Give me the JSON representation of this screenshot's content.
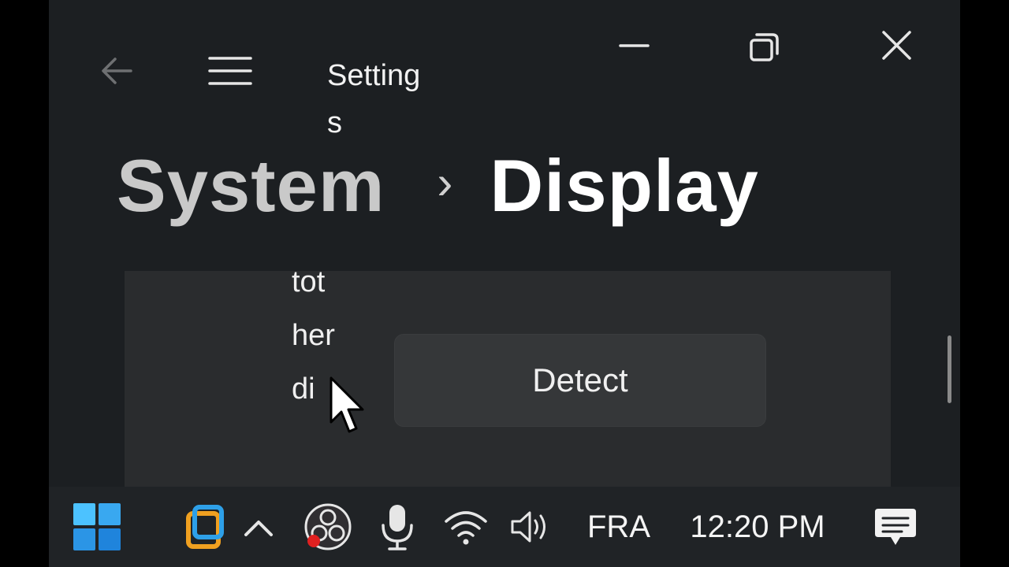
{
  "window": {
    "title": "Settings"
  },
  "breadcrumb": {
    "parent": "System",
    "separator": "›",
    "current": "Display"
  },
  "card": {
    "text": "tother di",
    "detect_label": "Detect"
  },
  "taskbar": {
    "language": "FRA",
    "time": "12:20 PM"
  },
  "icons": {
    "back": "back-arrow-icon",
    "menu": "hamburger-menu-icon",
    "minimize": "minimize-icon",
    "restore": "restore-icon",
    "close": "close-icon",
    "start": "windows-start-icon",
    "app": "app-icon",
    "tray_expand": "chevron-up-icon",
    "obs": "obs-icon",
    "mic": "microphone-icon",
    "wifi": "wifi-icon",
    "volume": "volume-icon",
    "notifications": "notifications-icon"
  },
  "colors": {
    "accent": "#4cc2ff",
    "background": "#1c1f22",
    "card": "#2a2c2e"
  }
}
